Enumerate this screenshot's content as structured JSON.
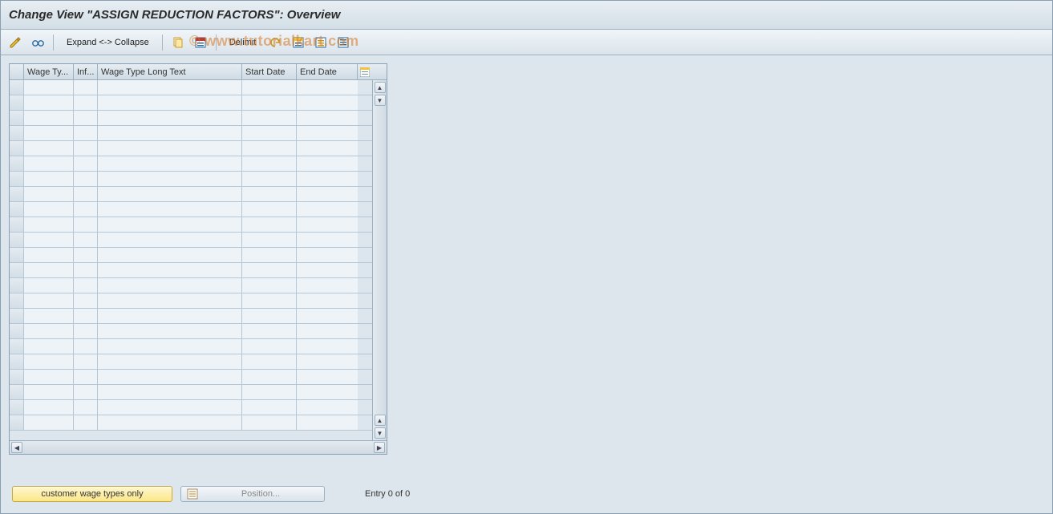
{
  "header": {
    "title": "Change View \"ASSIGN REDUCTION FACTORS\": Overview"
  },
  "watermark": "© www.tutorialkart.com",
  "toolbar": {
    "expand_collapse": "Expand <-> Collapse",
    "delimit": "Delimit"
  },
  "grid": {
    "columns": {
      "selector": "",
      "wage_type": "Wage Ty...",
      "inf": "Inf...",
      "long_text": "Wage Type Long Text",
      "start_date": "Start Date",
      "end_date": "End Date"
    },
    "rows": [
      {
        "wage_type": "",
        "inf": "",
        "long_text": "",
        "start_date": "",
        "end_date": ""
      },
      {
        "wage_type": "",
        "inf": "",
        "long_text": "",
        "start_date": "",
        "end_date": ""
      },
      {
        "wage_type": "",
        "inf": "",
        "long_text": "",
        "start_date": "",
        "end_date": ""
      },
      {
        "wage_type": "",
        "inf": "",
        "long_text": "",
        "start_date": "",
        "end_date": ""
      },
      {
        "wage_type": "",
        "inf": "",
        "long_text": "",
        "start_date": "",
        "end_date": ""
      },
      {
        "wage_type": "",
        "inf": "",
        "long_text": "",
        "start_date": "",
        "end_date": ""
      },
      {
        "wage_type": "",
        "inf": "",
        "long_text": "",
        "start_date": "",
        "end_date": ""
      },
      {
        "wage_type": "",
        "inf": "",
        "long_text": "",
        "start_date": "",
        "end_date": ""
      },
      {
        "wage_type": "",
        "inf": "",
        "long_text": "",
        "start_date": "",
        "end_date": ""
      },
      {
        "wage_type": "",
        "inf": "",
        "long_text": "",
        "start_date": "",
        "end_date": ""
      },
      {
        "wage_type": "",
        "inf": "",
        "long_text": "",
        "start_date": "",
        "end_date": ""
      },
      {
        "wage_type": "",
        "inf": "",
        "long_text": "",
        "start_date": "",
        "end_date": ""
      },
      {
        "wage_type": "",
        "inf": "",
        "long_text": "",
        "start_date": "",
        "end_date": ""
      },
      {
        "wage_type": "",
        "inf": "",
        "long_text": "",
        "start_date": "",
        "end_date": ""
      },
      {
        "wage_type": "",
        "inf": "",
        "long_text": "",
        "start_date": "",
        "end_date": ""
      },
      {
        "wage_type": "",
        "inf": "",
        "long_text": "",
        "start_date": "",
        "end_date": ""
      },
      {
        "wage_type": "",
        "inf": "",
        "long_text": "",
        "start_date": "",
        "end_date": ""
      },
      {
        "wage_type": "",
        "inf": "",
        "long_text": "",
        "start_date": "",
        "end_date": ""
      },
      {
        "wage_type": "",
        "inf": "",
        "long_text": "",
        "start_date": "",
        "end_date": ""
      },
      {
        "wage_type": "",
        "inf": "",
        "long_text": "",
        "start_date": "",
        "end_date": ""
      },
      {
        "wage_type": "",
        "inf": "",
        "long_text": "",
        "start_date": "",
        "end_date": ""
      },
      {
        "wage_type": "",
        "inf": "",
        "long_text": "",
        "start_date": "",
        "end_date": ""
      },
      {
        "wage_type": "",
        "inf": "",
        "long_text": "",
        "start_date": "",
        "end_date": ""
      }
    ]
  },
  "footer": {
    "customer_btn": "customer wage types only",
    "position_btn": "Position...",
    "entry_text": "Entry 0 of 0"
  }
}
